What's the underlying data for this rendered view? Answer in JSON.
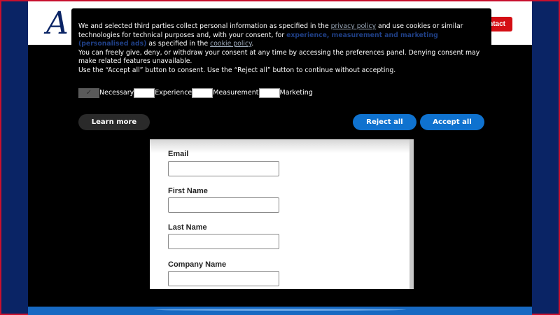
{
  "header": {
    "logo_text": "A",
    "contact_label": "ntact"
  },
  "form": {
    "fields": [
      {
        "label": "Email",
        "value": ""
      },
      {
        "label": "First Name",
        "value": ""
      },
      {
        "label": "Last Name",
        "value": ""
      },
      {
        "label": "Company Name",
        "value": ""
      }
    ]
  },
  "consent": {
    "text_a": "We and selected third parties collect personal information as specified in the ",
    "privacy_link": "privacy policy",
    "text_b": " and use cookies or similar technologies for technical purposes and, with your consent, for ",
    "purposes": "experience, measurement and marketing (personalised ads)",
    "text_c": " as specified in the ",
    "cookie_link": "cookie policy",
    "text_d": ".",
    "line2": "You can freely give, deny, or withdraw your consent at any time by accessing the preferences panel. Denying consent may make related features unavailable.",
    "line3": "Use the “Accept all” button to consent. Use the “Reject all” button to continue without accepting.",
    "checkboxes": [
      {
        "label": "Necessary",
        "checked": true
      },
      {
        "label": "Experience",
        "checked": false
      },
      {
        "label": "Measurement",
        "checked": false
      },
      {
        "label": "Marketing",
        "checked": false
      }
    ],
    "learn_more": "Learn more",
    "reject_all": "Reject all",
    "accept_all": "Accept all",
    "checkmark": "✓"
  }
}
